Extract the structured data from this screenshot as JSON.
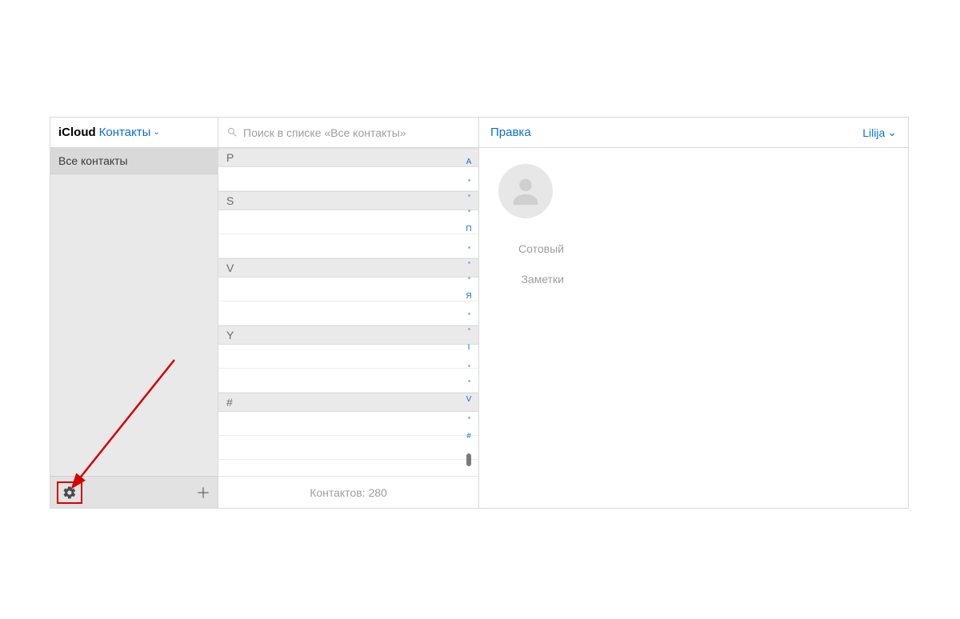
{
  "sidebar": {
    "brand": "iCloud",
    "dropdown": "Контакты",
    "items": [
      {
        "label": "Все контакты"
      }
    ]
  },
  "search": {
    "placeholder": "Поиск в списке «Все контакты»"
  },
  "sections": [
    "P",
    "S",
    "V",
    "Y",
    "#"
  ],
  "index_letters": [
    "А",
    "П",
    "Я",
    "I",
    "V",
    "#"
  ],
  "list_footer": "Контактов: 280",
  "detail": {
    "edit": "Правка",
    "user": "Lilija",
    "fields": {
      "phone_label": "Сотовый",
      "notes_label": "Заметки"
    }
  }
}
